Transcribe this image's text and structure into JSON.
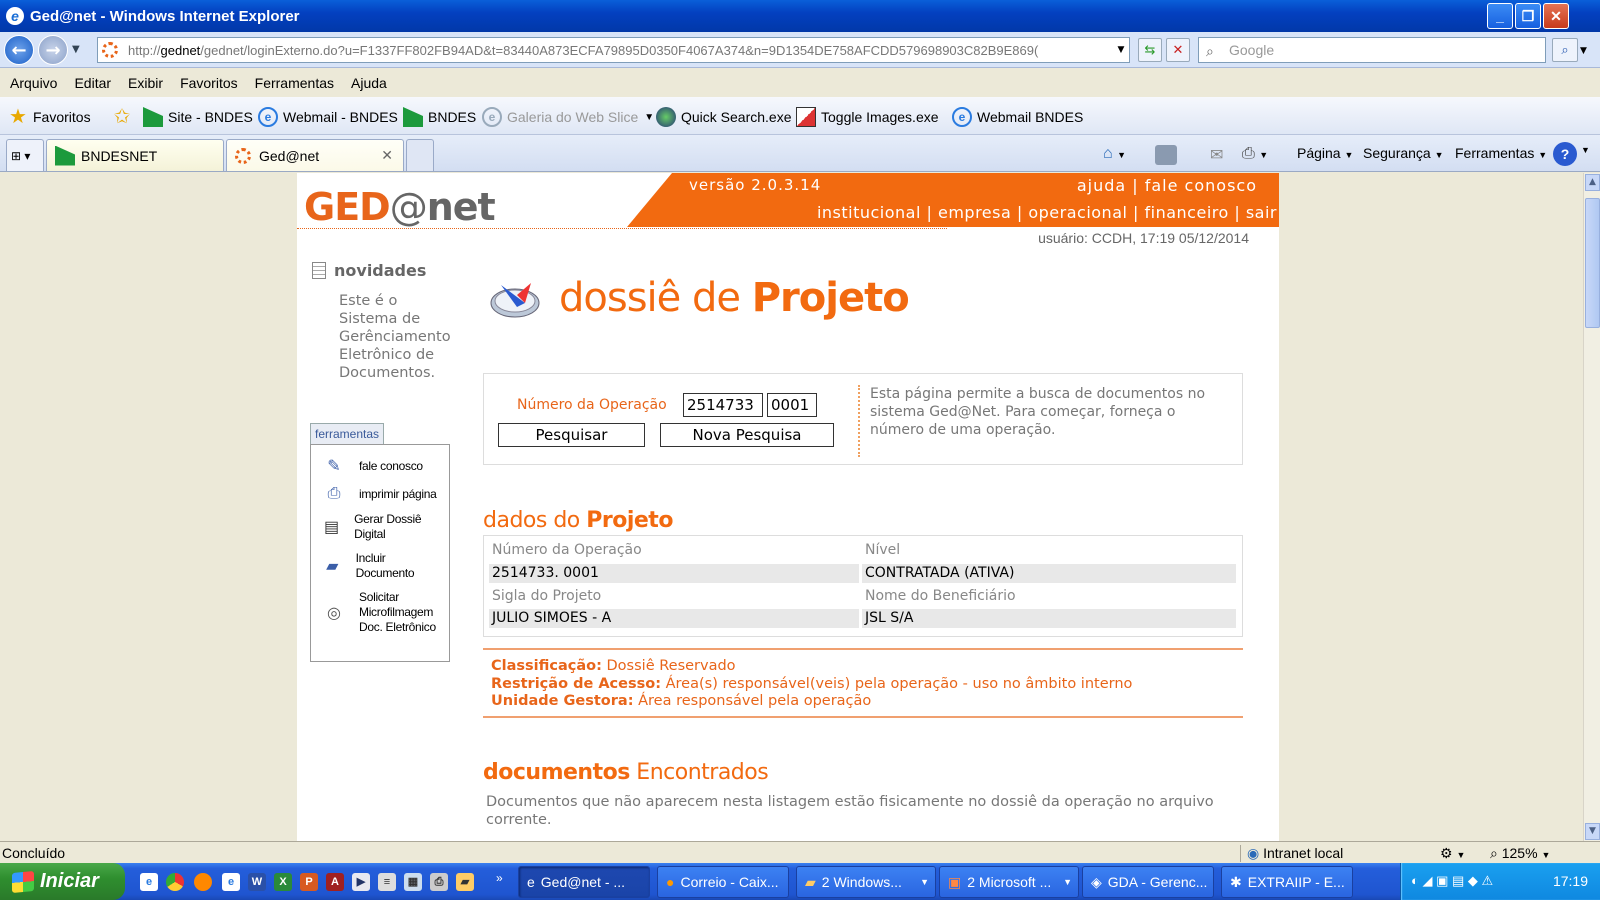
{
  "window": {
    "title": "Ged@net - Windows Internet Explorer"
  },
  "browser": {
    "address": "http://gednet/gednet/loginExterno.do?u=F1337FF802FB94AD&t=83440A873ECFA79895D0350F4067A374&n=9D1354DE758AFCDD579698903C82B9E8690",
    "address_host": "gednet",
    "address_prefix": "http://",
    "address_rest": "/gednet/loginExterno.do?u=F1337FF802FB94AD&t=83440A873ECFA79895D0350F4067A374&n=9D1354DE758AFCDD579698903C82B9E869(",
    "search_placeholder": "Google",
    "menu": [
      "Arquivo",
      "Editar",
      "Exibir",
      "Favoritos",
      "Ferramentas",
      "Ajuda"
    ],
    "favorites_label": "Favoritos",
    "favorites": [
      "Site - BNDES",
      "Webmail - BNDES",
      "BNDES",
      "Galeria do Web Slice",
      "Quick Search.exe",
      "Toggle Images.exe",
      "Webmail BNDES"
    ],
    "tabs": [
      "BNDESNET",
      "Ged@net"
    ],
    "commands": {
      "pagina": "Página",
      "seguranca": "Segurança",
      "ferramentas": "Ferramentas"
    },
    "status": "Concluído",
    "zone": "Intranet local",
    "zoom": "125%"
  },
  "site": {
    "logo_ged": "GED",
    "logo_at": "@",
    "logo_net": "net",
    "version": "versão  2.0.3.14",
    "help_links": "ajuda | fale conosco",
    "main_nav": "institucional | empresa | operacional | financeiro | sair",
    "user_line": "usuário: CCDH,    17:19 05/12/2014",
    "news_title": "novidades",
    "news_text": "Este é o Sistema de Gerênciamento Eletrônico de Documentos.",
    "tools_tab": "ferramentas",
    "tools": [
      "fale conosco",
      "imprimir página",
      "Gerar Dossiê Digital",
      "Incluir Documento",
      "Solicitar Microfilmagem Doc. Eletrônico"
    ]
  },
  "main": {
    "title_prefix": "dossiê de ",
    "title_bold": "Projeto",
    "search": {
      "label": "Número da Operação",
      "op_number": "2514733",
      "op_suffix": "0001",
      "search_button": "Pesquisar",
      "new_search_button": "Nova Pesquisa",
      "hint": "Esta página permite a busca de documentos no sistema Ged@Net. Para começar, forneça o número de uma operação."
    },
    "dados_prefix": "dados do ",
    "dados_bold": "Projeto",
    "fields": {
      "numero_label": "Número da Operação",
      "numero_value": "2514733. 0001",
      "nivel_label": "Nível",
      "nivel_value": "CONTRATADA (ATIVA)",
      "sigla_label": "Sigla do Projeto",
      "sigla_value": "JULIO SIMOES - A",
      "benef_label": "Nome do Beneficiário",
      "benef_value": "JSL S/A"
    },
    "classificacao_label": "Classificação:",
    "classificacao_value": " Dossiê Reservado",
    "restricao_label": "Restrição de Acesso:",
    "restricao_value": " Área(s) responsável(veis) pela operação - uso no âmbito interno",
    "unidade_label": "Unidade Gestora:",
    "unidade_value": " Área responsável pela operação",
    "docs_bold": "documentos",
    "docs_rest": " Encontrados",
    "docs_desc": "Documentos que não aparecem nesta listagem estão fisicamente no dossiê da operação no arquivo corrente."
  },
  "taskbar": {
    "start": "Iniciar",
    "buttons": [
      "Ged@net - ...",
      "Correio - Caix...",
      "2 Windows...",
      "2 Microsoft ...",
      "GDA - Gerenc...",
      "EXTRAIIP - E..."
    ],
    "clock": "17:19"
  }
}
